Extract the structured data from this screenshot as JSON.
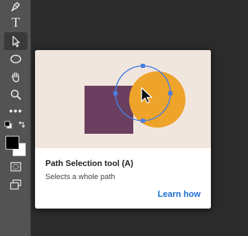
{
  "toolbar": {
    "tools": [
      {
        "name": "pen-tool",
        "icon": "pen-icon"
      },
      {
        "name": "type-tool",
        "icon": "type-icon",
        "glyph": "T"
      },
      {
        "name": "path-selection-tool",
        "icon": "arrow-pointer-icon",
        "active": true
      },
      {
        "name": "ellipse-tool",
        "icon": "ellipse-icon"
      },
      {
        "name": "hand-tool",
        "icon": "hand-icon"
      },
      {
        "name": "zoom-tool",
        "icon": "magnifier-icon"
      },
      {
        "name": "more-tools",
        "icon": "ellipsis-icon",
        "glyph": "•••"
      },
      {
        "name": "default-colors",
        "icon": "default-colors-icon"
      },
      {
        "name": "swap-colors",
        "icon": "swap-arrows-icon"
      },
      {
        "name": "quick-mask",
        "icon": "quick-mask-icon"
      },
      {
        "name": "screen-mode",
        "icon": "screen-mode-icon"
      }
    ],
    "foreground_color": "#000000",
    "background_color": "#ffffff"
  },
  "tooltip": {
    "title": "Path Selection tool (A)",
    "description": "Selects a whole path",
    "link_label": "Learn how",
    "colors": {
      "illustration_bg": "#f1e6de",
      "square": "#6a3f5f",
      "circle": "#eea32a",
      "path_outline": "#4a7fe0",
      "link": "#1f6fd1"
    }
  }
}
